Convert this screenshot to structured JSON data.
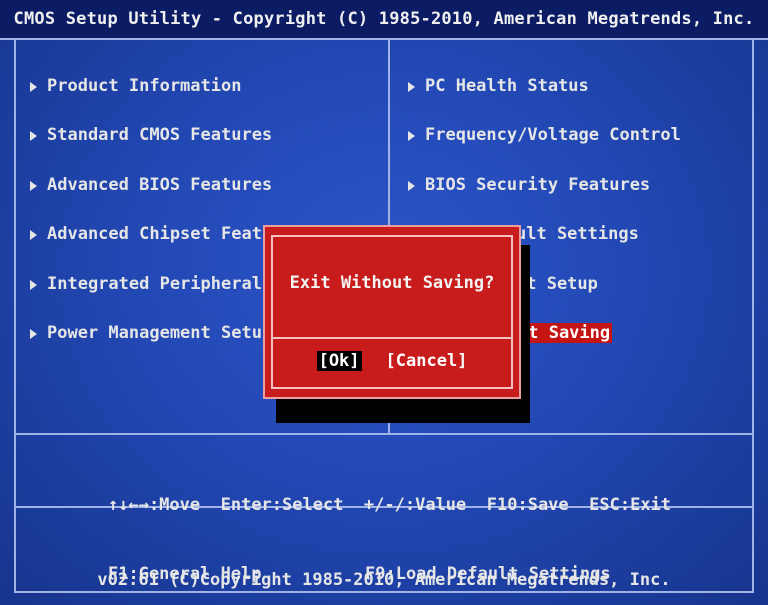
{
  "header": {
    "title": "CMOS Setup Utility - Copyright (C) 1985-2010, American Megatrends, Inc."
  },
  "menu": {
    "left": [
      {
        "label": "Product Information"
      },
      {
        "label": "Standard CMOS Features"
      },
      {
        "label": "Advanced BIOS Features"
      },
      {
        "label": "Advanced Chipset Featu"
      },
      {
        "label": "Integrated Peripherals"
      },
      {
        "label": "Power Management Setup"
      }
    ],
    "right": [
      {
        "label": "PC Health Status"
      },
      {
        "label": "Frequency/Voltage Control"
      },
      {
        "label": "BIOS Security Features"
      },
      {
        "label": "ult Settings"
      },
      {
        "label": "it Setup"
      },
      {
        "label": "ut Saving",
        "selected": true
      }
    ]
  },
  "dialog": {
    "question": "Exit Without Saving?",
    "ok_label": "[Ok]",
    "cancel_label": "[Cancel]"
  },
  "help": {
    "move": "↑↓←→:Move",
    "select": "Enter:Select",
    "value": "+/-/:Value",
    "save": "F10:Save",
    "exit": "ESC:Exit",
    "general_help": "F1:General Help",
    "load_defaults": "F9:Load Default Settings"
  },
  "footer": {
    "version": "v02.61 (C)Copyright 1985-2010, American Megatrends, Inc."
  },
  "colors": {
    "background": "#2248b4",
    "title_bar": "#0c1c64",
    "dialog": "#c81c1c",
    "highlight": "#c41414",
    "text": "#e6e6e6"
  }
}
